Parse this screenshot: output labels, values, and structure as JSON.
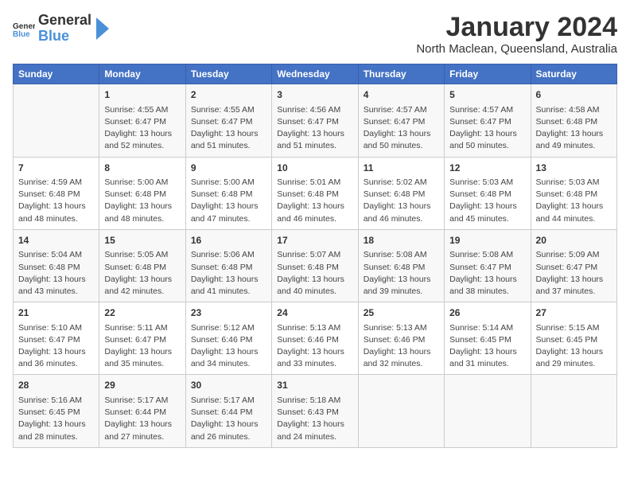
{
  "header": {
    "logo_general": "General",
    "logo_blue": "Blue",
    "month_title": "January 2024",
    "location": "North Maclean, Queensland, Australia"
  },
  "days_of_week": [
    "Sunday",
    "Monday",
    "Tuesday",
    "Wednesday",
    "Thursday",
    "Friday",
    "Saturday"
  ],
  "weeks": [
    [
      {
        "day": "",
        "content": ""
      },
      {
        "day": "1",
        "content": "Sunrise: 4:55 AM\nSunset: 6:47 PM\nDaylight: 13 hours\nand 52 minutes."
      },
      {
        "day": "2",
        "content": "Sunrise: 4:55 AM\nSunset: 6:47 PM\nDaylight: 13 hours\nand 51 minutes."
      },
      {
        "day": "3",
        "content": "Sunrise: 4:56 AM\nSunset: 6:47 PM\nDaylight: 13 hours\nand 51 minutes."
      },
      {
        "day": "4",
        "content": "Sunrise: 4:57 AM\nSunset: 6:47 PM\nDaylight: 13 hours\nand 50 minutes."
      },
      {
        "day": "5",
        "content": "Sunrise: 4:57 AM\nSunset: 6:47 PM\nDaylight: 13 hours\nand 50 minutes."
      },
      {
        "day": "6",
        "content": "Sunrise: 4:58 AM\nSunset: 6:48 PM\nDaylight: 13 hours\nand 49 minutes."
      }
    ],
    [
      {
        "day": "7",
        "content": "Sunrise: 4:59 AM\nSunset: 6:48 PM\nDaylight: 13 hours\nand 48 minutes."
      },
      {
        "day": "8",
        "content": "Sunrise: 5:00 AM\nSunset: 6:48 PM\nDaylight: 13 hours\nand 48 minutes."
      },
      {
        "day": "9",
        "content": "Sunrise: 5:00 AM\nSunset: 6:48 PM\nDaylight: 13 hours\nand 47 minutes."
      },
      {
        "day": "10",
        "content": "Sunrise: 5:01 AM\nSunset: 6:48 PM\nDaylight: 13 hours\nand 46 minutes."
      },
      {
        "day": "11",
        "content": "Sunrise: 5:02 AM\nSunset: 6:48 PM\nDaylight: 13 hours\nand 46 minutes."
      },
      {
        "day": "12",
        "content": "Sunrise: 5:03 AM\nSunset: 6:48 PM\nDaylight: 13 hours\nand 45 minutes."
      },
      {
        "day": "13",
        "content": "Sunrise: 5:03 AM\nSunset: 6:48 PM\nDaylight: 13 hours\nand 44 minutes."
      }
    ],
    [
      {
        "day": "14",
        "content": "Sunrise: 5:04 AM\nSunset: 6:48 PM\nDaylight: 13 hours\nand 43 minutes."
      },
      {
        "day": "15",
        "content": "Sunrise: 5:05 AM\nSunset: 6:48 PM\nDaylight: 13 hours\nand 42 minutes."
      },
      {
        "day": "16",
        "content": "Sunrise: 5:06 AM\nSunset: 6:48 PM\nDaylight: 13 hours\nand 41 minutes."
      },
      {
        "day": "17",
        "content": "Sunrise: 5:07 AM\nSunset: 6:48 PM\nDaylight: 13 hours\nand 40 minutes."
      },
      {
        "day": "18",
        "content": "Sunrise: 5:08 AM\nSunset: 6:48 PM\nDaylight: 13 hours\nand 39 minutes."
      },
      {
        "day": "19",
        "content": "Sunrise: 5:08 AM\nSunset: 6:47 PM\nDaylight: 13 hours\nand 38 minutes."
      },
      {
        "day": "20",
        "content": "Sunrise: 5:09 AM\nSunset: 6:47 PM\nDaylight: 13 hours\nand 37 minutes."
      }
    ],
    [
      {
        "day": "21",
        "content": "Sunrise: 5:10 AM\nSunset: 6:47 PM\nDaylight: 13 hours\nand 36 minutes."
      },
      {
        "day": "22",
        "content": "Sunrise: 5:11 AM\nSunset: 6:47 PM\nDaylight: 13 hours\nand 35 minutes."
      },
      {
        "day": "23",
        "content": "Sunrise: 5:12 AM\nSunset: 6:46 PM\nDaylight: 13 hours\nand 34 minutes."
      },
      {
        "day": "24",
        "content": "Sunrise: 5:13 AM\nSunset: 6:46 PM\nDaylight: 13 hours\nand 33 minutes."
      },
      {
        "day": "25",
        "content": "Sunrise: 5:13 AM\nSunset: 6:46 PM\nDaylight: 13 hours\nand 32 minutes."
      },
      {
        "day": "26",
        "content": "Sunrise: 5:14 AM\nSunset: 6:45 PM\nDaylight: 13 hours\nand 31 minutes."
      },
      {
        "day": "27",
        "content": "Sunrise: 5:15 AM\nSunset: 6:45 PM\nDaylight: 13 hours\nand 29 minutes."
      }
    ],
    [
      {
        "day": "28",
        "content": "Sunrise: 5:16 AM\nSunset: 6:45 PM\nDaylight: 13 hours\nand 28 minutes."
      },
      {
        "day": "29",
        "content": "Sunrise: 5:17 AM\nSunset: 6:44 PM\nDaylight: 13 hours\nand 27 minutes."
      },
      {
        "day": "30",
        "content": "Sunrise: 5:17 AM\nSunset: 6:44 PM\nDaylight: 13 hours\nand 26 minutes."
      },
      {
        "day": "31",
        "content": "Sunrise: 5:18 AM\nSunset: 6:43 PM\nDaylight: 13 hours\nand 24 minutes."
      },
      {
        "day": "",
        "content": ""
      },
      {
        "day": "",
        "content": ""
      },
      {
        "day": "",
        "content": ""
      }
    ]
  ]
}
